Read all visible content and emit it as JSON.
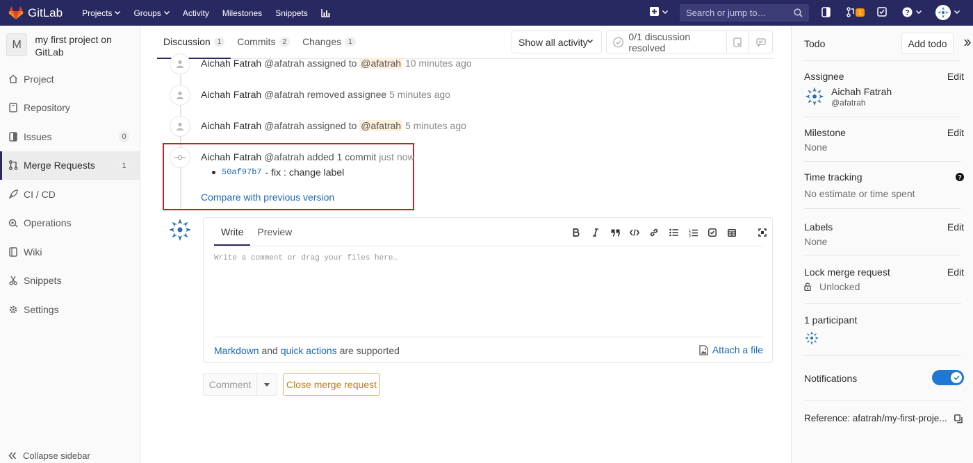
{
  "app": {
    "name": "GitLab"
  },
  "topnav": {
    "links": [
      {
        "label": "Projects",
        "dropdown": true
      },
      {
        "label": "Groups",
        "dropdown": true
      },
      {
        "label": "Activity",
        "dropdown": false
      },
      {
        "label": "Milestones",
        "dropdown": false
      },
      {
        "label": "Snippets",
        "dropdown": false
      }
    ],
    "search_placeholder": "Search or jump to…",
    "mr_count": "1"
  },
  "sidebar": {
    "project_initial": "M",
    "project_name": "my first project on GitLab",
    "items": [
      {
        "label": "Project",
        "icon": "home-icon"
      },
      {
        "label": "Repository",
        "icon": "book-icon"
      },
      {
        "label": "Issues",
        "icon": "issues-icon",
        "count": "0"
      },
      {
        "label": "Merge Requests",
        "icon": "merge-request-icon",
        "count": "1"
      },
      {
        "label": "CI / CD",
        "icon": "rocket-icon"
      },
      {
        "label": "Operations",
        "icon": "cloud-gear-icon"
      },
      {
        "label": "Wiki",
        "icon": "wiki-icon"
      },
      {
        "label": "Snippets",
        "icon": "scissors-icon"
      },
      {
        "label": "Settings",
        "icon": "settings-icon"
      }
    ],
    "collapse_label": "Collapse sidebar"
  },
  "tabs": [
    {
      "label": "Discussion",
      "count": "1"
    },
    {
      "label": "Commits",
      "count": "2"
    },
    {
      "label": "Changes",
      "count": "1"
    }
  ],
  "activity_filter": "Show all activity",
  "resolved": "0/1 discussion resolved",
  "events": [
    {
      "author": "Aichah Fatrah",
      "handle": "@afatrah",
      "action": "assigned to",
      "mention": "@afatrah",
      "time": "10 minutes ago"
    },
    {
      "author": "Aichah Fatrah",
      "handle": "@afatrah",
      "action": "removed assignee",
      "mention": "",
      "time": "5 minutes ago"
    },
    {
      "author": "Aichah Fatrah",
      "handle": "@afatrah",
      "action": "assigned to",
      "mention": "@afatrah",
      "time": "5 minutes ago"
    },
    {
      "author": "Aichah Fatrah",
      "handle": "@afatrah",
      "action": "added 1 commit",
      "mention": "",
      "time": "just now"
    }
  ],
  "commit": {
    "sha": "50af97b7",
    "message": "- fix : change label"
  },
  "compare_link": "Compare with previous version",
  "editor": {
    "write_tab": "Write",
    "preview_tab": "Preview",
    "placeholder": "Write a comment or drag your files here…",
    "markdown_link": "Markdown",
    "and_text": "and",
    "quick_actions_link": "quick actions",
    "supported_text": "are supported",
    "attach_label": "Attach a file"
  },
  "actions": {
    "comment": "Comment",
    "close": "Close merge request"
  },
  "right": {
    "todo_title": "Todo",
    "add_todo": "Add todo",
    "assignee_title": "Assignee",
    "assignee_name": "Aichah Fatrah",
    "assignee_handle": "@afatrah",
    "edit": "Edit",
    "milestone_title": "Milestone",
    "milestone_value": "None",
    "time_title": "Time tracking",
    "time_value": "No estimate or time spent",
    "labels_title": "Labels",
    "labels_value": "None",
    "lock_title": "Lock merge request",
    "lock_value": "Unlocked",
    "participants": "1 participant",
    "notifications": "Notifications",
    "notifications_on": true,
    "reference": "Reference: afatrah/my-first-proje..."
  }
}
